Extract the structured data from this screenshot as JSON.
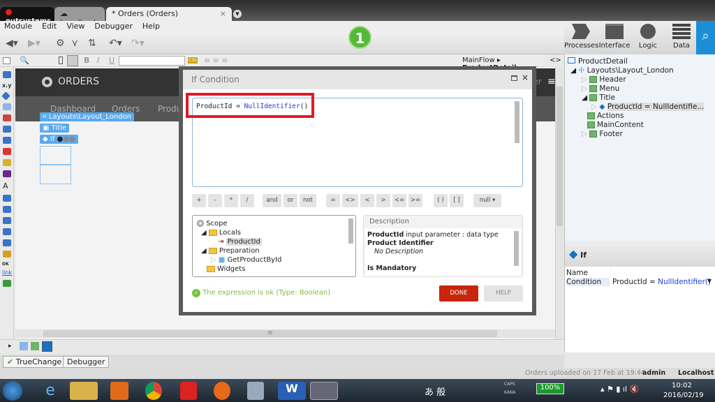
{
  "titlebar": {
    "logo": "outsystems",
    "tabs": [
      "Localhost",
      "* Orders (Orders)"
    ]
  },
  "menu": [
    "Module",
    "Edit",
    "View",
    "Debugger",
    "Help"
  ],
  "notification_count": "1",
  "right_tabs": [
    "Processes",
    "Interface",
    "Logic",
    "Data"
  ],
  "toolbar2": {
    "css_label": "CSS",
    "breadcrumb": "MainFlow",
    "breadcrumb_current": "ProductDetail",
    "code_toggle": "<>"
  },
  "canvas": {
    "app_title": "ORDERS",
    "nav": [
      "Dashboard",
      "Orders",
      "Produc"
    ],
    "user_fragment": "ser",
    "widgets": {
      "layout": "Layouts\\Layout_London",
      "title": "Title",
      "if": "If"
    },
    "hscroll_grip": "III"
  },
  "dialog": {
    "title": "If Condition",
    "expression_var": "ProductId = ",
    "expression_fn": "NullIdentifier",
    "expression_tail": "()",
    "operators": [
      "+",
      "-",
      "*",
      "/",
      "and",
      "or",
      "not",
      "=",
      "<>",
      "<",
      ">",
      "<=",
      ">=",
      "( )",
      "[ ]"
    ],
    "null_select": "null",
    "scope_tree": [
      "Scope",
      "Locals",
      "ProductId",
      "Preparation",
      "GetProductById",
      "Widgets"
    ],
    "description": {
      "header": "Description",
      "name": "ProductId",
      "type_text": " input parameter : data type",
      "data_type": "Product Identifier",
      "no_desc": "No Description",
      "mandatory": "Is Mandatory"
    },
    "status": "The expression is ok (Type: Boolean)",
    "done": "DONE",
    "help": "HELP"
  },
  "tree": {
    "root": "ProductDetail",
    "layout": "Layouts\\Layout_London",
    "items": [
      "Header",
      "Menu",
      "Title",
      "ProductId = NullIdentifie...",
      "Actions",
      "MainContent",
      "Footer"
    ]
  },
  "properties": {
    "title": "If",
    "rows": [
      {
        "label": "Name",
        "value": ""
      },
      {
        "label": "Condition",
        "value_var": "ProductId = ",
        "value_fn": "NullIdentifier()"
      }
    ]
  },
  "bottom_tabs": [
    "TrueChange™",
    "Debugger"
  ],
  "status": {
    "message": "Orders uploaded on 17 Feb at 19:44",
    "user": "admin",
    "server": "Localhost"
  },
  "taskbar": {
    "battery": "100%",
    "time": "10:02",
    "date": "2016/02/19",
    "caps": "CAPS",
    "kana": "KANA",
    "ime": "あ 般"
  },
  "colors": {
    "accent": "#1a8fd6",
    "done": "#c8260a",
    "ok": "#7ac142",
    "badge": "#56b93a"
  }
}
